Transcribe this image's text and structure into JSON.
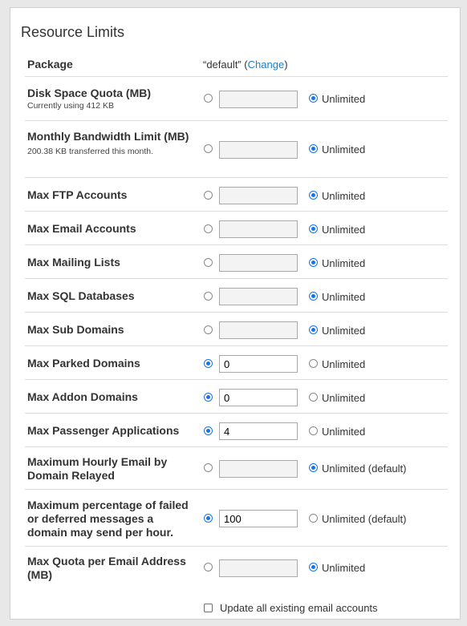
{
  "panel": {
    "title": "Resource Limits"
  },
  "package": {
    "label": "Package",
    "value_prefix": "“default” (",
    "change_link": "Change",
    "value_suffix": ")"
  },
  "rows": [
    {
      "label": "Disk Space Quota (MB)",
      "sub": "Currently using 412 KB",
      "mode": "unlimited",
      "value": "",
      "unlimited_label": "Unlimited"
    },
    {
      "label": "Monthly Bandwidth Limit (MB)",
      "sub": "200.38 KB transferred this month.",
      "mode": "unlimited",
      "value": "",
      "unlimited_label": "Unlimited"
    },
    {
      "label": "Max FTP Accounts",
      "sub": "",
      "mode": "unlimited",
      "value": "",
      "unlimited_label": "Unlimited"
    },
    {
      "label": "Max Email Accounts",
      "sub": "",
      "mode": "unlimited",
      "value": "",
      "unlimited_label": "Unlimited"
    },
    {
      "label": "Max Mailing Lists",
      "sub": "",
      "mode": "unlimited",
      "value": "",
      "unlimited_label": "Unlimited"
    },
    {
      "label": "Max SQL Databases",
      "sub": "",
      "mode": "unlimited",
      "value": "",
      "unlimited_label": "Unlimited"
    },
    {
      "label": "Max Sub Domains",
      "sub": "",
      "mode": "unlimited",
      "value": "",
      "unlimited_label": "Unlimited"
    },
    {
      "label": "Max Parked Domains",
      "sub": "",
      "mode": "limited",
      "value": "0",
      "unlimited_label": "Unlimited"
    },
    {
      "label": "Max Addon Domains",
      "sub": "",
      "mode": "limited",
      "value": "0",
      "unlimited_label": "Unlimited"
    },
    {
      "label": "Max Passenger Applications",
      "sub": "",
      "mode": "limited",
      "value": "4",
      "unlimited_label": "Unlimited"
    },
    {
      "label": "Maximum Hourly Email by Domain Relayed",
      "sub": "",
      "mode": "unlimited",
      "value": "",
      "unlimited_label": "Unlimited (default)"
    },
    {
      "label": "Maximum percentage of failed or deferred messages a domain may send per hour.",
      "sub": "",
      "mode": "limited",
      "value": "100",
      "unlimited_label": "Unlimited (default)"
    },
    {
      "label": "Max Quota per Email Address (MB)",
      "sub": "",
      "mode": "unlimited",
      "value": "",
      "unlimited_label": "Unlimited"
    }
  ],
  "update_accounts": {
    "label": "Update all existing email accounts",
    "checked": false
  },
  "colors": {
    "accent": "#1a73e8",
    "link": "#1a7fc8",
    "background": "#e8e8e8"
  }
}
